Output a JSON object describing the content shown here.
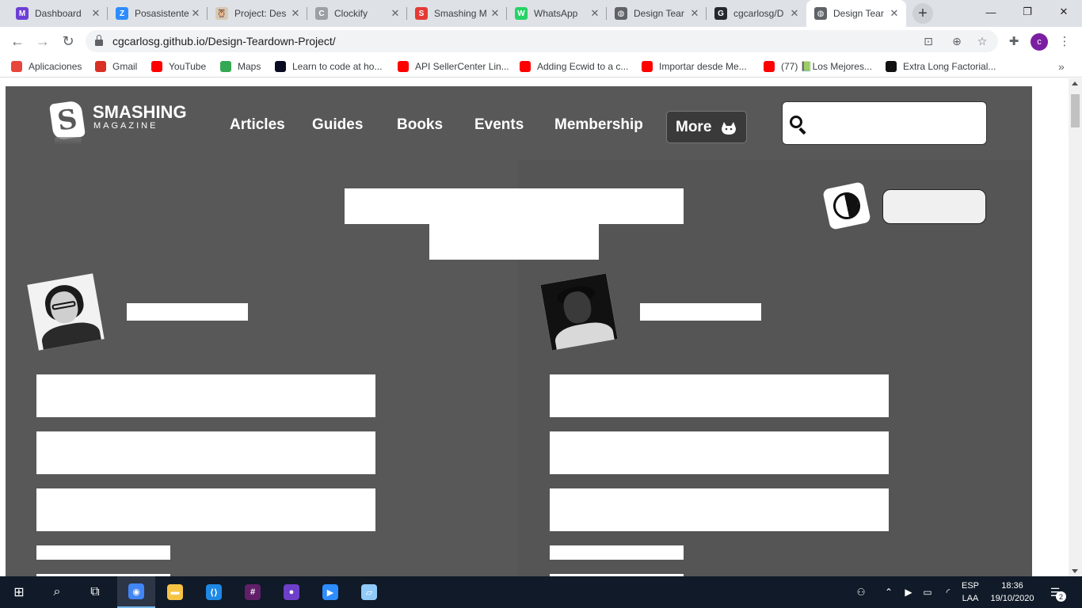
{
  "browser": {
    "tabs": [
      {
        "title": "Dashboard",
        "favicon": "M",
        "color": "#6d3fd6"
      },
      {
        "title": "Posasistente",
        "favicon": "Z",
        "color": "#2d8cff"
      },
      {
        "title": "Project: Des",
        "favicon": "🦉",
        "color": "#d7c9b3"
      },
      {
        "title": "Clockify",
        "favicon": "C",
        "color": "#9aa0a6"
      },
      {
        "title": "Smashing M",
        "favicon": "S",
        "color": "#e53935"
      },
      {
        "title": "WhatsApp",
        "favicon": "W",
        "color": "#25d366"
      },
      {
        "title": "Design Tear",
        "favicon": "◍",
        "color": "#5f6368"
      },
      {
        "title": "cgcarlosg/D",
        "favicon": "G",
        "color": "#24292e"
      },
      {
        "title": "Design Tear",
        "favicon": "◍",
        "color": "#5f6368"
      }
    ],
    "active_tab_index": 8,
    "close_glyph": "✕",
    "new_tab_glyph": "+",
    "window_controls": {
      "minimize": "—",
      "restore": "❐",
      "close": "✕"
    },
    "url": "cgcarlosg.github.io/Design-Teardown-Project/",
    "profile_initial": "c",
    "bookmarks": [
      {
        "label": "Aplicaciones",
        "icon": "apps-grid-icon",
        "color": "#e8453c"
      },
      {
        "label": "Gmail",
        "icon": "gmail-icon",
        "color": "#d93025"
      },
      {
        "label": "YouTube",
        "icon": "youtube-icon",
        "color": "#ff0000"
      },
      {
        "label": "Maps",
        "icon": "maps-icon",
        "color": "#34a853"
      },
      {
        "label": "Learn to code at ho...",
        "icon": "freecodecamp-icon",
        "color": "#0a0a23"
      },
      {
        "label": "API SellerCenter Lin...",
        "icon": "youtube-icon",
        "color": "#ff0000"
      },
      {
        "label": "Adding Ecwid to a c...",
        "icon": "youtube-icon",
        "color": "#ff0000"
      },
      {
        "label": "Importar desde Me...",
        "icon": "youtube-icon",
        "color": "#ff0000"
      },
      {
        "label": "(77) 📗Los Mejores...",
        "icon": "youtube-icon",
        "color": "#ff0000"
      },
      {
        "label": "Extra Long Factorial...",
        "icon": "hackerrank-icon",
        "color": "#111111"
      }
    ],
    "bookmarks_overflow": "»"
  },
  "site": {
    "logo_name": "SMASHING",
    "logo_sub": "MAGAZINE",
    "logo_mark": "S",
    "nav": [
      "Articles",
      "Guides",
      "Books",
      "Events",
      "Membership"
    ],
    "more_label": "More",
    "search_placeholder": ""
  },
  "taskbar": {
    "start_glyph": "⊞",
    "search_glyph": "⌕",
    "taskview_glyph": "⧉",
    "apps": [
      {
        "name": "chrome",
        "label": "◉",
        "color": "#4285f4"
      },
      {
        "name": "file-explorer",
        "label": "▬",
        "color": "#f6c343"
      },
      {
        "name": "vscode",
        "label": "⟨⟩",
        "color": "#1e88e5"
      },
      {
        "name": "slack",
        "label": "#",
        "color": "#611f69"
      },
      {
        "name": "github-desktop",
        "label": "●",
        "color": "#6e40c9"
      },
      {
        "name": "zoom",
        "label": "▶",
        "color": "#2d8cff"
      },
      {
        "name": "notes",
        "label": "▱",
        "color": "#90caf9"
      }
    ],
    "lang_top": "ESP",
    "lang_bottom": "LAA",
    "time": "18:36",
    "date": "19/10/2020",
    "notifications": "2"
  }
}
